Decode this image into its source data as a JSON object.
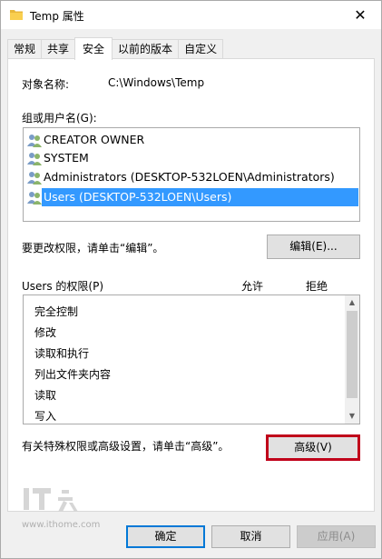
{
  "window": {
    "title": "Temp 属性",
    "close_glyph": "✕"
  },
  "tabs": [
    {
      "label": "常规"
    },
    {
      "label": "共享"
    },
    {
      "label": "安全"
    },
    {
      "label": "以前的版本"
    },
    {
      "label": "自定义"
    }
  ],
  "object": {
    "label": "对象名称:",
    "value": "C:\\Windows\\Temp"
  },
  "users": {
    "label": "组或用户名(G):",
    "items": [
      {
        "name": "CREATOR OWNER"
      },
      {
        "name": "SYSTEM"
      },
      {
        "name": "Administrators (DESKTOP-532LOEN\\Administrators)"
      },
      {
        "name": "Users (DESKTOP-532LOEN\\Users)",
        "selected": true
      }
    ],
    "selection_color": "#3399ff"
  },
  "edit": {
    "hint": "要更改权限，请单击“编辑”。",
    "button": "编辑(E)..."
  },
  "permissions": {
    "label": "Users 的权限(P)",
    "col_allow": "允许",
    "col_deny": "拒绝",
    "items": [
      "完全控制",
      "修改",
      "读取和执行",
      "列出文件夹内容",
      "读取",
      "写入"
    ]
  },
  "advanced": {
    "hint": "有关特殊权限或高级设置，请单击“高级”。",
    "button": "高级(V)",
    "highlight_color": "#c0001a"
  },
  "footer": {
    "ok": "确定",
    "cancel": "取消",
    "apply": "应用(A)"
  },
  "watermark": {
    "logo": "IT之家",
    "url": "www.ithome.com"
  }
}
